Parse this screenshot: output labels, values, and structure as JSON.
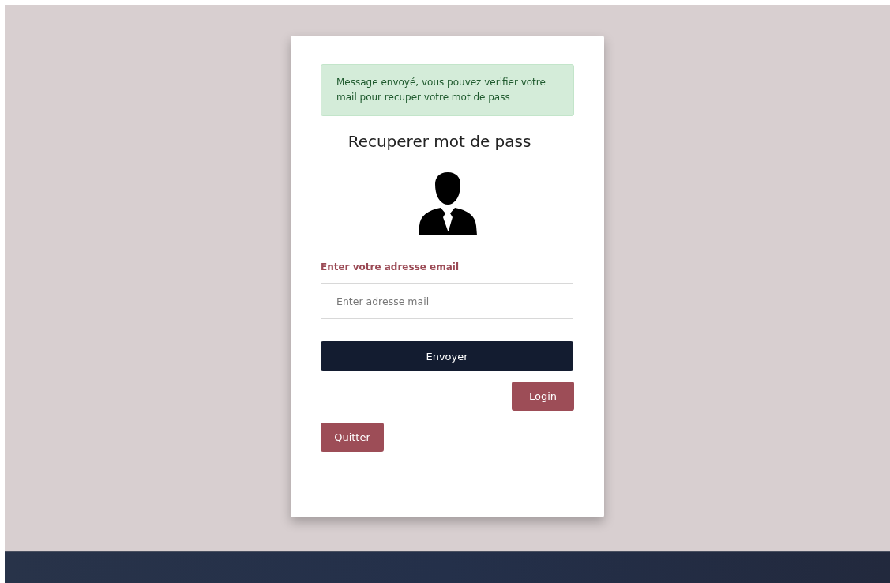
{
  "alert": {
    "message": "Message envoyé, vous pouvez verifier votre mail pour recuper votre mot de pass"
  },
  "title": "Recuperer mot de pass",
  "email_field": {
    "label": "Enter votre adresse email",
    "placeholder": "Enter adresse mail"
  },
  "buttons": [
    {
      "label": "Envoyer",
      "kind": "primary"
    },
    {
      "label": "Login",
      "kind": "right"
    },
    {
      "label": "Quitter",
      "kind": "left"
    }
  ]
}
